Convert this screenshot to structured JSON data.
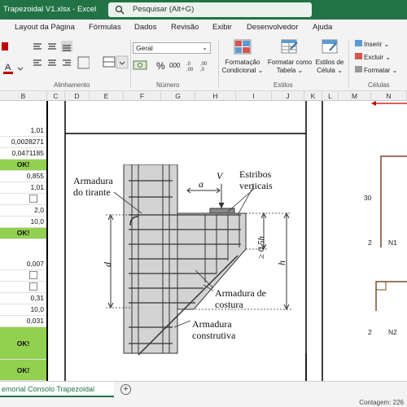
{
  "titlebar": {
    "file_title": "Trapezoidal V1.xlsx  -  Excel",
    "search_placeholder": "Pesquisar (Alt+G)"
  },
  "menu": [
    "Layout da Página",
    "Fórmulas",
    "Dados",
    "Revisão",
    "Exibir",
    "Desenvolvedor",
    "Ajuda"
  ],
  "ribbon": {
    "font_name": "Geral",
    "groups": {
      "alignment": "Alinhamento",
      "number": "Número",
      "styles": "Estilos",
      "cells": "Células"
    },
    "styles_buttons": {
      "cond_format": [
        "Formatação",
        "Condicional"
      ],
      "format_table": [
        "Formatar como",
        "Tabela"
      ],
      "cell_styles": [
        "Estilos de",
        "Célula"
      ]
    },
    "cells_buttons": {
      "insert": "Inserir",
      "delete": "Excluir",
      "format": "Formatar"
    },
    "number_symbols": {
      "percent": "%",
      "thousands": "000"
    }
  },
  "columns": [
    "B",
    "C",
    "D",
    "E",
    "F",
    "G",
    "H",
    "I",
    "J",
    "K",
    "L",
    "M",
    "N"
  ],
  "column_b_cells": [
    "1,01",
    "0,0028271",
    "0,0471185",
    "OK!",
    "0,855",
    "1,01",
    "",
    "2,0",
    "10,0",
    "OK!",
    "",
    "",
    "0,007",
    "",
    "",
    "0,31",
    "10,0",
    "0,031",
    "OK!",
    "OK!"
  ],
  "diagram": {
    "labels": {
      "tie_rebar_1": "Armadura",
      "tie_rebar_2": "do tirante",
      "a": "a",
      "V": "V",
      "stirrups_1": "Estribos",
      "stirrups_2": "verticais",
      "half_h": "≥ 0,5h",
      "h": "h",
      "d": "d",
      "sewing_1": "Armadura de",
      "sewing_2": "costura",
      "constructive_1": "Armadura",
      "constructive_2": "construtiva"
    }
  },
  "right_panel": {
    "value_30": "30",
    "n1_index": "2",
    "n1_label": "N1",
    "n2_index": "2",
    "n2_label": "N2"
  },
  "sheet_tab": "emorial Consolo Trapezoidal",
  "status": {
    "count": "Contagem: 226"
  },
  "colors": {
    "excel_green": "#217346",
    "ok_green": "#92d050",
    "arrow_red": "#c00000",
    "drawing_brown": "#7b4a2a"
  }
}
